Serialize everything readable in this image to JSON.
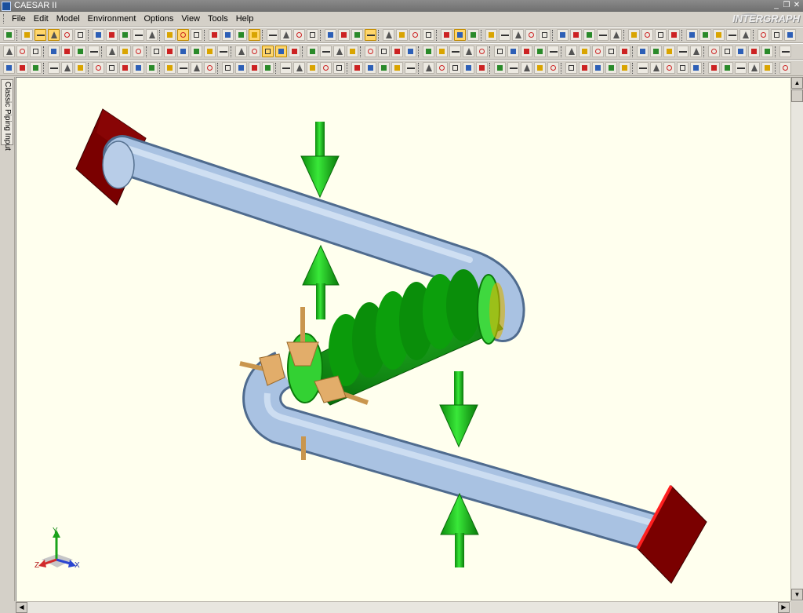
{
  "window": {
    "title": "CAESAR II",
    "brand": "INTERGRAPH",
    "controls": {
      "minimize": "_",
      "restore": "❐",
      "close": "✕"
    }
  },
  "menu": {
    "items": [
      "File",
      "Edit",
      "Model",
      "Environment",
      "Options",
      "View",
      "Tools",
      "Help"
    ]
  },
  "side_tab": {
    "label": "Classic Piping Input"
  },
  "axes_triad": {
    "x": "X",
    "y": "Y",
    "z": "Z"
  },
  "colors": {
    "viewport_bg": "#ffffee",
    "pipe": "#a9c2e2",
    "anchor": "#7a0000",
    "anchor_edge": "#ff2020",
    "restraint_arrow": "#1fc21f",
    "expansion_joint": "#0f8c0f",
    "guide": "#e2ad6a"
  }
}
